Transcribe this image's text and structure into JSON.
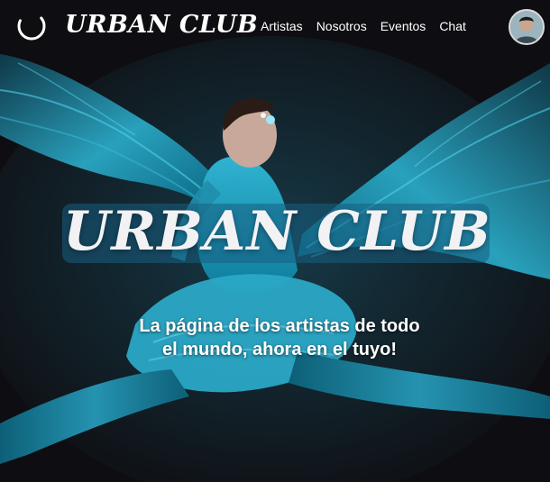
{
  "header": {
    "brand": "URBAN CLUB",
    "nav": [
      "Artistas",
      "Nosotros",
      "Eventos",
      "Chat"
    ]
  },
  "hero": {
    "title": "URBAN CLUB",
    "tagline": "La página de los artistas de todo el mundo, ahora en el tuyo!"
  },
  "icons": {
    "logo": "loading-ring-icon",
    "profile": "user-avatar"
  },
  "colors": {
    "background": "#0e0d11",
    "accent": "#1b9fc0",
    "text": "#ffffff"
  }
}
